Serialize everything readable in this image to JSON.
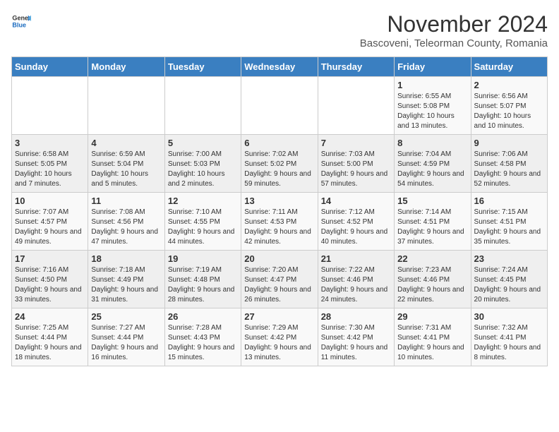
{
  "logo": {
    "general": "General",
    "blue": "Blue"
  },
  "title": "November 2024",
  "subtitle": "Bascoveni, Teleorman County, Romania",
  "headers": [
    "Sunday",
    "Monday",
    "Tuesday",
    "Wednesday",
    "Thursday",
    "Friday",
    "Saturday"
  ],
  "weeks": [
    [
      {
        "day": "",
        "info": ""
      },
      {
        "day": "",
        "info": ""
      },
      {
        "day": "",
        "info": ""
      },
      {
        "day": "",
        "info": ""
      },
      {
        "day": "",
        "info": ""
      },
      {
        "day": "1",
        "info": "Sunrise: 6:55 AM\nSunset: 5:08 PM\nDaylight: 10 hours and 13 minutes."
      },
      {
        "day": "2",
        "info": "Sunrise: 6:56 AM\nSunset: 5:07 PM\nDaylight: 10 hours and 10 minutes."
      }
    ],
    [
      {
        "day": "3",
        "info": "Sunrise: 6:58 AM\nSunset: 5:05 PM\nDaylight: 10 hours and 7 minutes."
      },
      {
        "day": "4",
        "info": "Sunrise: 6:59 AM\nSunset: 5:04 PM\nDaylight: 10 hours and 5 minutes."
      },
      {
        "day": "5",
        "info": "Sunrise: 7:00 AM\nSunset: 5:03 PM\nDaylight: 10 hours and 2 minutes."
      },
      {
        "day": "6",
        "info": "Sunrise: 7:02 AM\nSunset: 5:02 PM\nDaylight: 9 hours and 59 minutes."
      },
      {
        "day": "7",
        "info": "Sunrise: 7:03 AM\nSunset: 5:00 PM\nDaylight: 9 hours and 57 minutes."
      },
      {
        "day": "8",
        "info": "Sunrise: 7:04 AM\nSunset: 4:59 PM\nDaylight: 9 hours and 54 minutes."
      },
      {
        "day": "9",
        "info": "Sunrise: 7:06 AM\nSunset: 4:58 PM\nDaylight: 9 hours and 52 minutes."
      }
    ],
    [
      {
        "day": "10",
        "info": "Sunrise: 7:07 AM\nSunset: 4:57 PM\nDaylight: 9 hours and 49 minutes."
      },
      {
        "day": "11",
        "info": "Sunrise: 7:08 AM\nSunset: 4:56 PM\nDaylight: 9 hours and 47 minutes."
      },
      {
        "day": "12",
        "info": "Sunrise: 7:10 AM\nSunset: 4:55 PM\nDaylight: 9 hours and 44 minutes."
      },
      {
        "day": "13",
        "info": "Sunrise: 7:11 AM\nSunset: 4:53 PM\nDaylight: 9 hours and 42 minutes."
      },
      {
        "day": "14",
        "info": "Sunrise: 7:12 AM\nSunset: 4:52 PM\nDaylight: 9 hours and 40 minutes."
      },
      {
        "day": "15",
        "info": "Sunrise: 7:14 AM\nSunset: 4:51 PM\nDaylight: 9 hours and 37 minutes."
      },
      {
        "day": "16",
        "info": "Sunrise: 7:15 AM\nSunset: 4:51 PM\nDaylight: 9 hours and 35 minutes."
      }
    ],
    [
      {
        "day": "17",
        "info": "Sunrise: 7:16 AM\nSunset: 4:50 PM\nDaylight: 9 hours and 33 minutes."
      },
      {
        "day": "18",
        "info": "Sunrise: 7:18 AM\nSunset: 4:49 PM\nDaylight: 9 hours and 31 minutes."
      },
      {
        "day": "19",
        "info": "Sunrise: 7:19 AM\nSunset: 4:48 PM\nDaylight: 9 hours and 28 minutes."
      },
      {
        "day": "20",
        "info": "Sunrise: 7:20 AM\nSunset: 4:47 PM\nDaylight: 9 hours and 26 minutes."
      },
      {
        "day": "21",
        "info": "Sunrise: 7:22 AM\nSunset: 4:46 PM\nDaylight: 9 hours and 24 minutes."
      },
      {
        "day": "22",
        "info": "Sunrise: 7:23 AM\nSunset: 4:46 PM\nDaylight: 9 hours and 22 minutes."
      },
      {
        "day": "23",
        "info": "Sunrise: 7:24 AM\nSunset: 4:45 PM\nDaylight: 9 hours and 20 minutes."
      }
    ],
    [
      {
        "day": "24",
        "info": "Sunrise: 7:25 AM\nSunset: 4:44 PM\nDaylight: 9 hours and 18 minutes."
      },
      {
        "day": "25",
        "info": "Sunrise: 7:27 AM\nSunset: 4:44 PM\nDaylight: 9 hours and 16 minutes."
      },
      {
        "day": "26",
        "info": "Sunrise: 7:28 AM\nSunset: 4:43 PM\nDaylight: 9 hours and 15 minutes."
      },
      {
        "day": "27",
        "info": "Sunrise: 7:29 AM\nSunset: 4:42 PM\nDaylight: 9 hours and 13 minutes."
      },
      {
        "day": "28",
        "info": "Sunrise: 7:30 AM\nSunset: 4:42 PM\nDaylight: 9 hours and 11 minutes."
      },
      {
        "day": "29",
        "info": "Sunrise: 7:31 AM\nSunset: 4:41 PM\nDaylight: 9 hours and 10 minutes."
      },
      {
        "day": "30",
        "info": "Sunrise: 7:32 AM\nSunset: 4:41 PM\nDaylight: 9 hours and 8 minutes."
      }
    ]
  ]
}
